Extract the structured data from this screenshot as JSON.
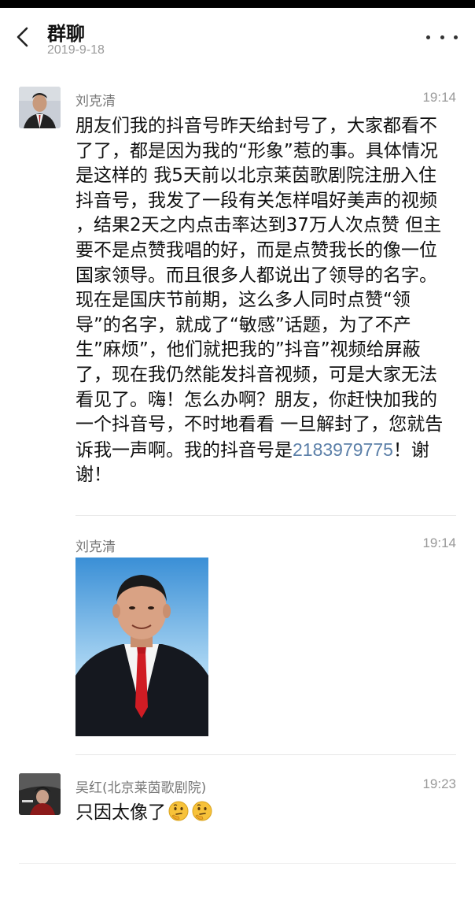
{
  "header": {
    "title": "群聊",
    "date": "2019-9-18",
    "back_icon": "chevron-left-icon",
    "more_icon": "more-dots-icon"
  },
  "messages": [
    {
      "sender": "刘克清",
      "time": "19:14",
      "type": "text",
      "text_before": "朋友们我的抖音号昨天给封号了，大家都看不了了，都是因为我的“形象”惹的事。具体情况是这样的 我5天前以北京莱茵歌剧院注册入住抖音号，我发了一段有关怎样唱好美声的视频 ，结果2天之内点击率达到37万人次点赞 但主要不是点赞我唱的好，而是点赞我长的像一位国家领导。而且很多人都说出了领导的名字。现在是国庆节前期，这么多人同时点赞“领导”的名字，就成了“敏感”话题，为了不产生”麻烦”，他们就把我的”抖音”视频给屏蔽了，现在我仍然能发抖音视频，可是大家无法看见了。嗨！怎么办啊？朋友，你赶快加我的一个抖音号，不时地看看 一旦解封了，您就告诉我一声啊。我的抖音号是",
      "link_number": "2183979775",
      "text_after": "！谢谢！"
    },
    {
      "sender": "刘克清",
      "time": "19:14",
      "type": "image"
    },
    {
      "sender": "吴红(北京莱茵歌剧院)",
      "time": "19:23",
      "type": "text",
      "text": "只因太像了",
      "emoji_icon": "thinking-face-emoji"
    }
  ]
}
